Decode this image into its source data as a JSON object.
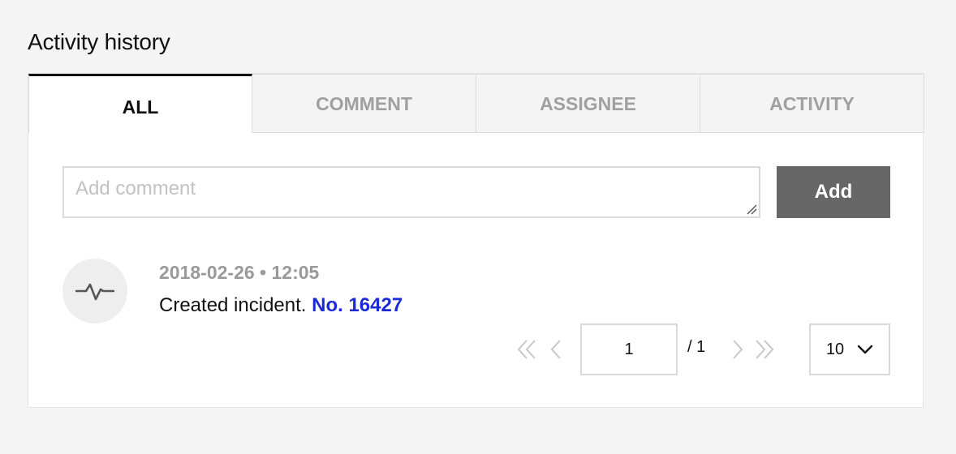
{
  "section": {
    "title": "Activity history"
  },
  "tabs": [
    {
      "label": "ALL",
      "active": true
    },
    {
      "label": "COMMENT",
      "active": false
    },
    {
      "label": "ASSIGNEE",
      "active": false
    },
    {
      "label": "ACTIVITY",
      "active": false
    }
  ],
  "comment": {
    "placeholder": "Add comment",
    "value": "",
    "add_label": "Add"
  },
  "activity": {
    "icon": "activity-pulse-icon",
    "meta": "2018-02-26 • 12:05",
    "text": "Created incident.",
    "link_text": "No. 16427"
  },
  "pagination": {
    "current_page": "1",
    "total_label": "/ 1",
    "page_size": "10"
  },
  "colors": {
    "add_button_bg": "#666666",
    "link": "#1a2bd6",
    "active_tab_border": "#111111"
  }
}
